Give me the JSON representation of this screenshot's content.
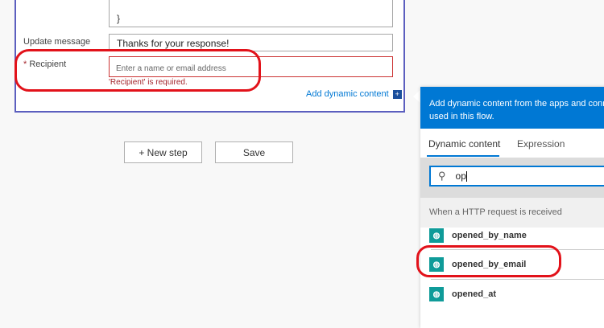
{
  "form": {
    "code_closing": "}",
    "update_label": "Update message",
    "update_value": "Thanks for your response!",
    "recipient_required": "*",
    "recipient_label": "Recipient",
    "recipient_placeholder": "Enter a name or email address",
    "recipient_error": "'Recipient' is required.",
    "add_dynamic": "Add dynamic content"
  },
  "actions": {
    "new_step": "+ New step",
    "save": "Save"
  },
  "panel": {
    "header": "Add dynamic content from the apps and connectors used in this flow.",
    "tabs": [
      "Dynamic content",
      "Expression"
    ],
    "search_value": "op",
    "section": "When a HTTP request is received",
    "items": [
      "opened_by_name",
      "opened_by_email",
      "opened_at"
    ]
  },
  "colors": {
    "accent": "#0078d4",
    "error": "#a4262c",
    "icon": "#0f9b99",
    "highlight": "#e2121a"
  }
}
